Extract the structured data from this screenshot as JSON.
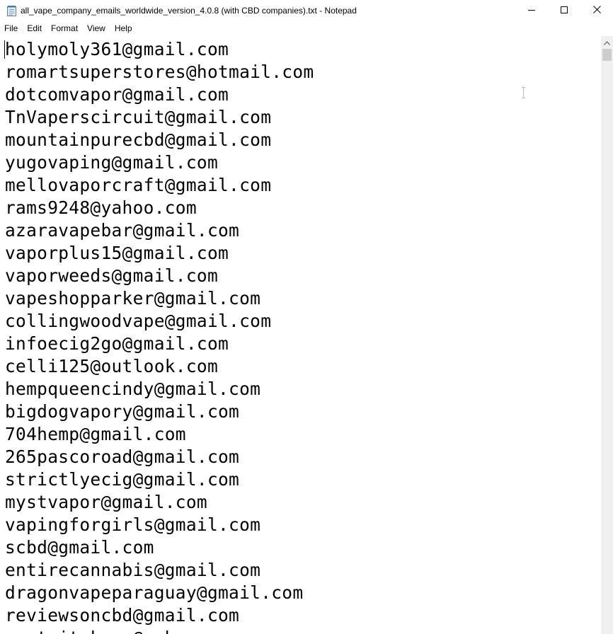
{
  "window": {
    "title": "all_vape_company_emails_worldwide_version_4.0.8 (with CBD companies).txt - Notepad"
  },
  "icons": {
    "app": "notepad-icon",
    "minimize": "minimize-icon",
    "maximize": "maximize-icon",
    "close": "close-icon",
    "scroll_up": "chevron-up-icon",
    "cursor": "text-cursor-icon"
  },
  "menu": {
    "file": "File",
    "edit": "Edit",
    "format": "Format",
    "view": "View",
    "help": "Help"
  },
  "editor": {
    "lines": [
      "holymoly361@gmail.com",
      "romartsuperstores@hotmail.com",
      "dotcomvapor@gmail.com",
      "TnVaperscircuit@gmail.com",
      "mountainpurecbd@gmail.com",
      "yugovaping@gmail.com",
      "mellovaporcraft@gmail.com",
      "rams9248@yahoo.com",
      "azaravapebar@gmail.com",
      "vaporplus15@gmail.com",
      "vaporweeds@gmail.com",
      "vapeshopparker@gmail.com",
      "collingwoodvape@gmail.com",
      "infoecig2go@gmail.com",
      "celli125@outlook.com",
      "hempqueencindy@gmail.com",
      "bigdogvapory@gmail.com",
      "704hemp@gmail.com",
      "265pascoroad@gmail.com",
      "strictlyecig@gmail.com",
      "mystvapor@gmail.com",
      "vapingforgirls@gmail.com",
      "scbd@gmail.com",
      "entirecannabis@gmail.com",
      "dragonvapeparaguay@gmail.com",
      "reviewsoncbd@gmail.com",
      "paptaitykays@yahoo.com"
    ]
  },
  "colors": {
    "background": "#ffffff",
    "text": "#000000",
    "scrollbar_track": "#f0f0f0",
    "scrollbar_thumb": "#cdcdcd"
  }
}
